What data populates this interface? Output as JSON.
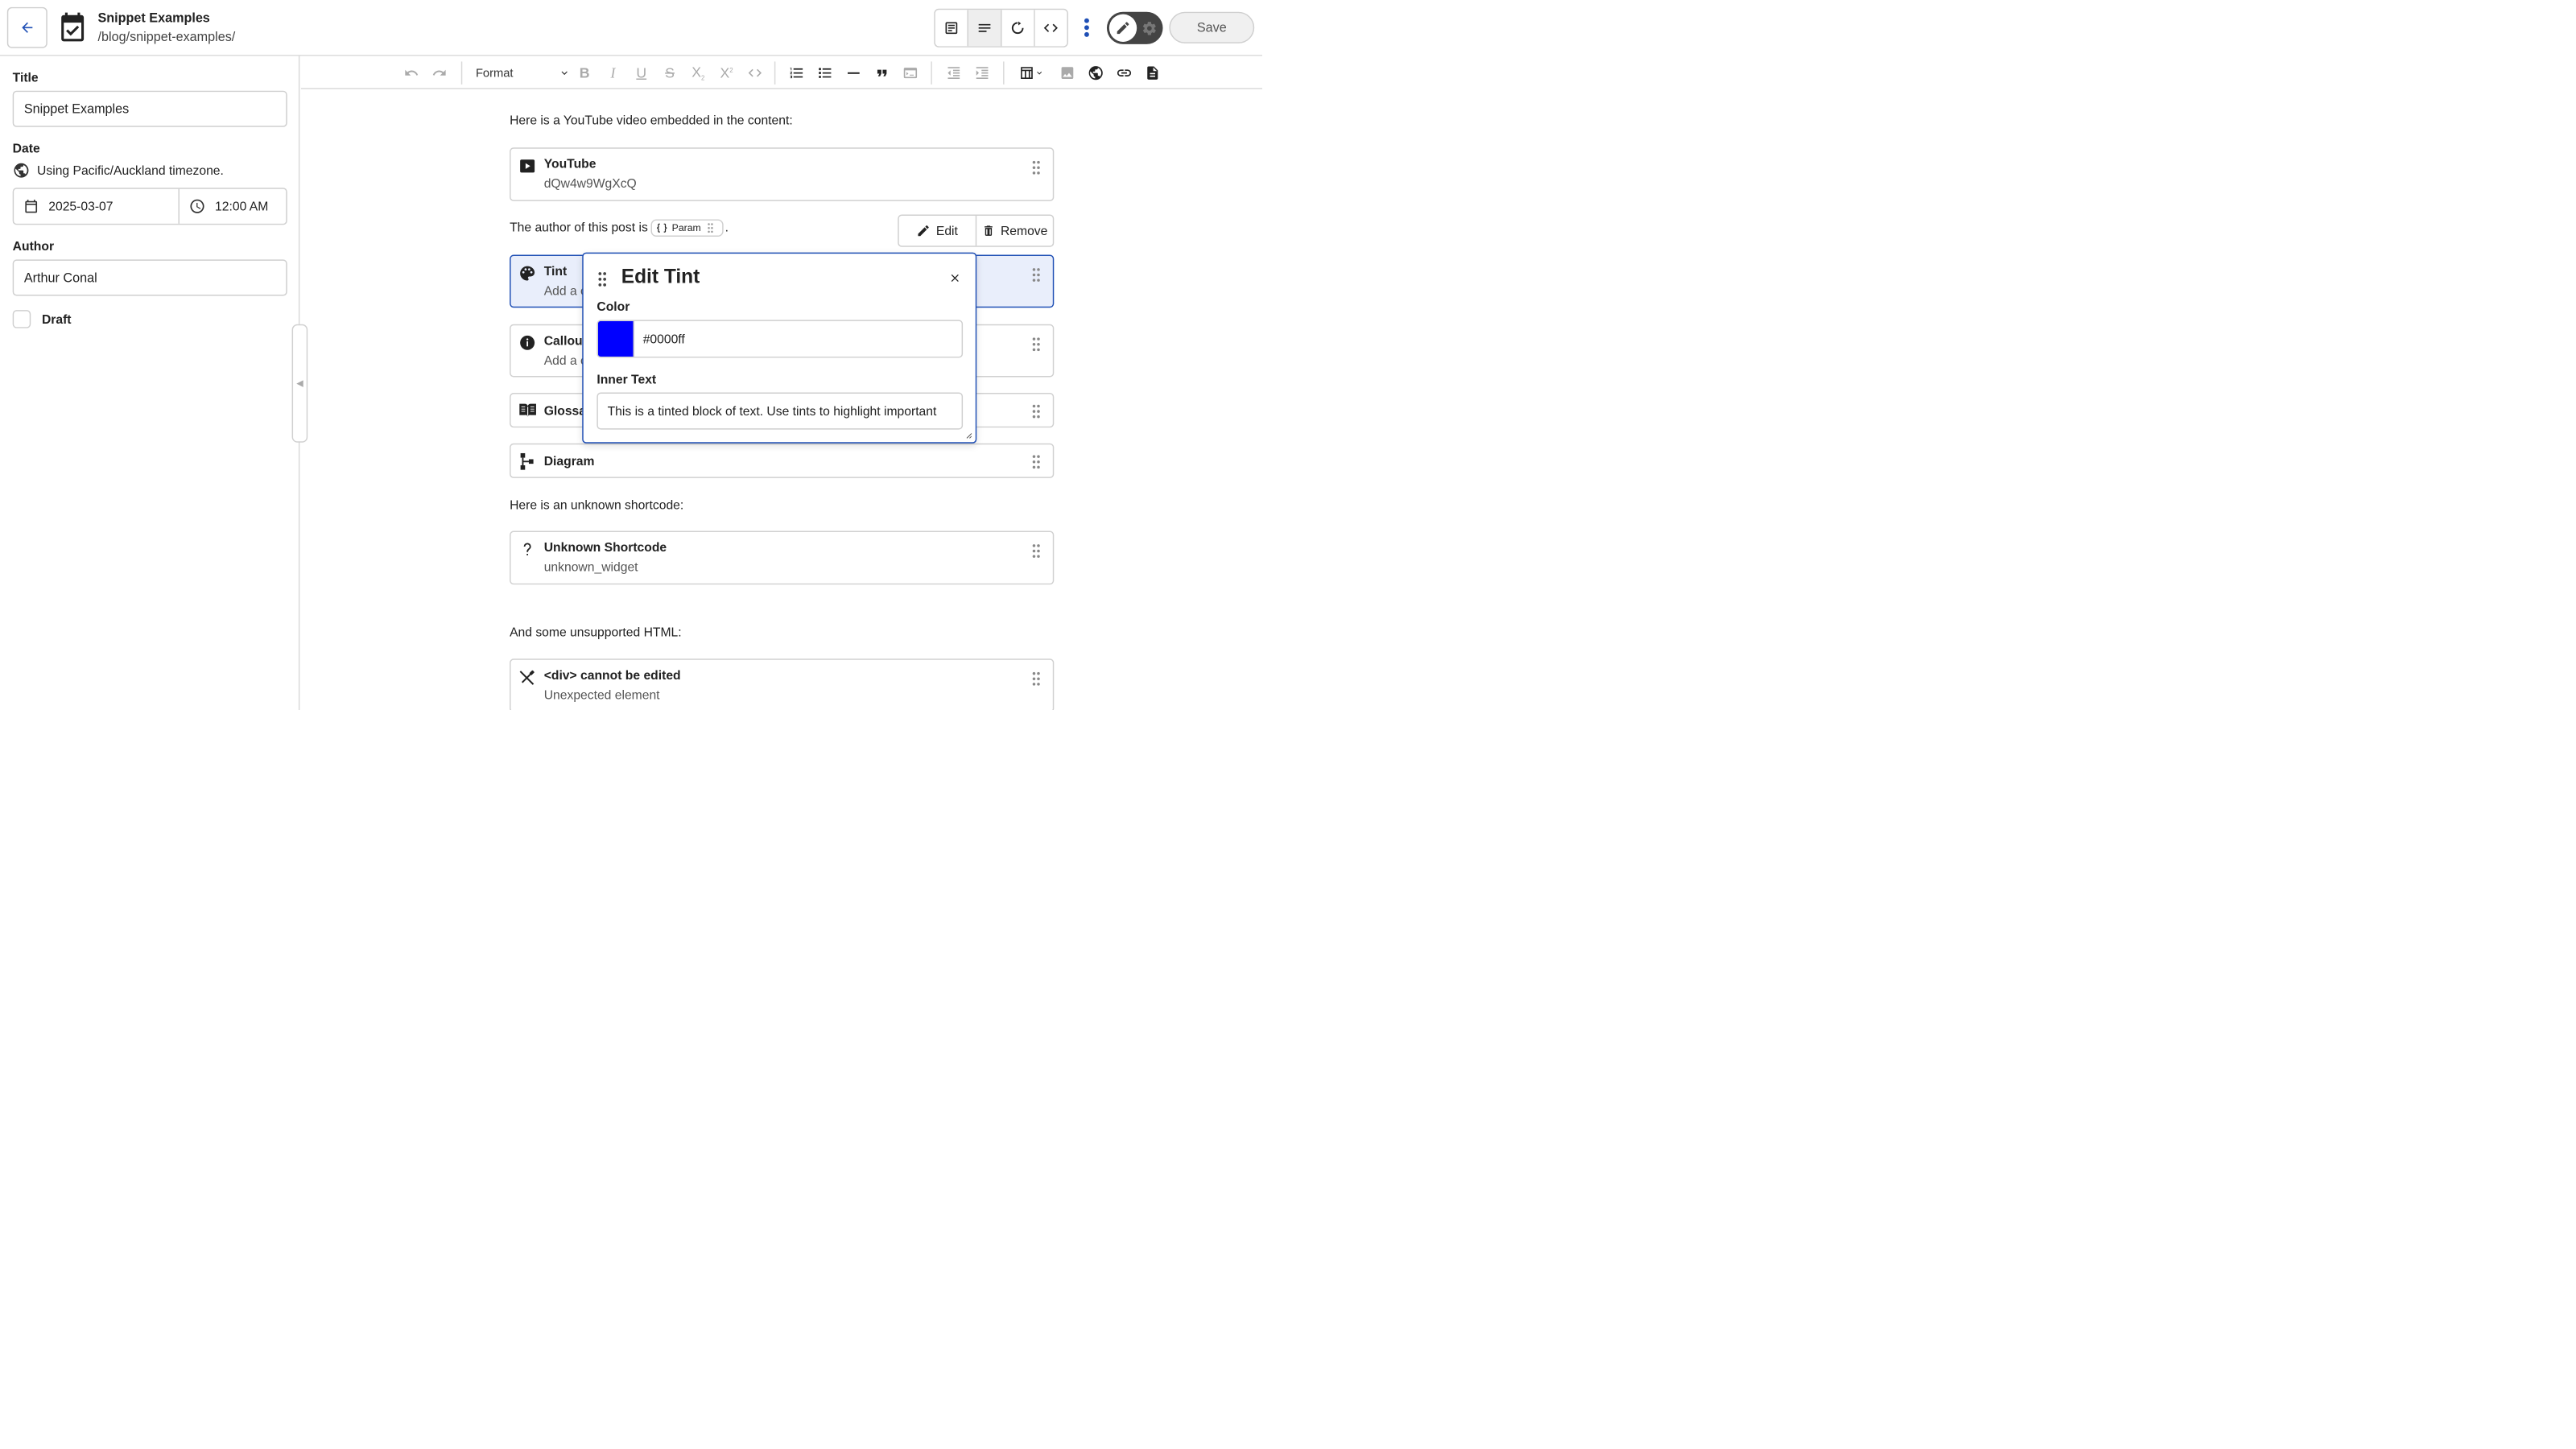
{
  "header": {
    "title": "Snippet Examples",
    "path": "/blog/snippet-examples/",
    "save_label": "Save"
  },
  "sidebar": {
    "title_label": "Title",
    "title_value": "Snippet Examples",
    "date_label": "Date",
    "timezone_text": "Using Pacific/Auckland timezone.",
    "date_value": "2025-03-07",
    "time_value": "12:00 AM",
    "author_label": "Author",
    "author_value": "Arthur Conal",
    "draft_label": "Draft"
  },
  "toolbar": {
    "format_label": "Format"
  },
  "content": {
    "para_youtube": "Here is a YouTube video embedded in the content:",
    "youtube_title": "YouTube",
    "youtube_id": "dQw4w9WgXcQ",
    "author_prefix": "The author of this post is",
    "param_label": "Param",
    "author_suffix": ".",
    "tint_title": "Tint",
    "tint_sub": "Add a c",
    "callout_title": "Callout",
    "callout_sub": "Add a c",
    "glossary_title": "Glossa",
    "diagram_title": "Diagram",
    "para_unknown": "Here is an unknown shortcode:",
    "unknown_title": "Unknown Shortcode",
    "unknown_sub": "unknown_widget",
    "para_html": "And some unsupported HTML:",
    "div_title": "<div> cannot be edited",
    "div_sub": "Unexpected element",
    "edit_label": "Edit",
    "remove_label": "Remove"
  },
  "popover": {
    "title": "Edit Tint",
    "color_label": "Color",
    "color_value": "#0000ff",
    "inner_text_label": "Inner Text",
    "inner_text_value": "This is a tinted block of text. Use tints to highlight important"
  },
  "colors": {
    "accent": "#1f4fb5",
    "swatch": "#0000ff"
  }
}
